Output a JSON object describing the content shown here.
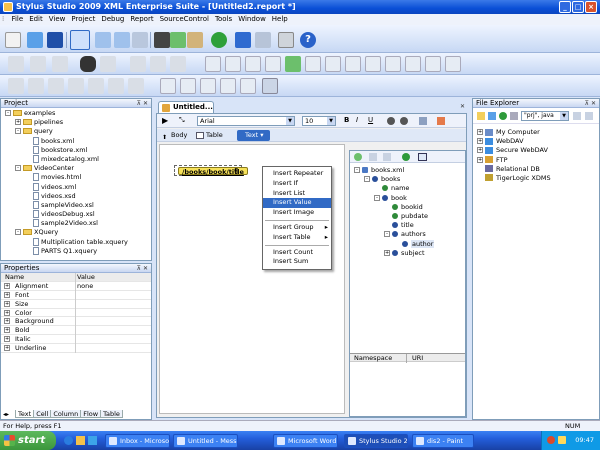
{
  "window": {
    "title": "Stylus Studio 2009 XML Enterprise Suite - [Untitled2.report *]"
  },
  "menu": [
    "File",
    "Edit",
    "View",
    "Project",
    "Debug",
    "Report",
    "SourceControl",
    "Tools",
    "Window",
    "Help"
  ],
  "project_panel": {
    "title": "Project",
    "tree": [
      {
        "label": "examples",
        "level": 0,
        "kind": "folder",
        "exp": "-"
      },
      {
        "label": "pipelines",
        "level": 1,
        "kind": "folder",
        "exp": "+"
      },
      {
        "label": "query",
        "level": 1,
        "kind": "folder",
        "exp": "-"
      },
      {
        "label": "books.xml",
        "level": 2,
        "kind": "file"
      },
      {
        "label": "bookstore.xml",
        "level": 2,
        "kind": "file"
      },
      {
        "label": "mixedcatalog.xml",
        "level": 2,
        "kind": "file"
      },
      {
        "label": "VideoCenter",
        "level": 1,
        "kind": "folder",
        "exp": "-"
      },
      {
        "label": "movies.html",
        "level": 2,
        "kind": "file"
      },
      {
        "label": "videos.xml",
        "level": 2,
        "kind": "file"
      },
      {
        "label": "videos.xsd",
        "level": 2,
        "kind": "file"
      },
      {
        "label": "sampleVideo.xsl",
        "level": 2,
        "kind": "file"
      },
      {
        "label": "videosDebug.xsl",
        "level": 2,
        "kind": "file"
      },
      {
        "label": "sample2Video.xsl",
        "level": 2,
        "kind": "file"
      },
      {
        "label": "XQuery",
        "level": 1,
        "kind": "folder",
        "exp": "-"
      },
      {
        "label": "Multiplication table.xquery",
        "level": 2,
        "kind": "file"
      },
      {
        "label": "PARTS Q1.xquery",
        "level": 2,
        "kind": "file"
      }
    ]
  },
  "properties_panel": {
    "title": "Properties",
    "col_name": "Name",
    "col_value": "Value",
    "rows": [
      {
        "name": "Alignment",
        "value": "none"
      },
      {
        "name": "Font",
        "value": ""
      },
      {
        "name": "Size",
        "value": ""
      },
      {
        "name": "Color",
        "value": ""
      },
      {
        "name": "Background",
        "value": ""
      },
      {
        "name": "Bold",
        "value": ""
      },
      {
        "name": "Italic",
        "value": ""
      },
      {
        "name": "Underline",
        "value": ""
      }
    ],
    "tabs": [
      "Text",
      "Cell",
      "Column",
      "Flow",
      "Table"
    ]
  },
  "editor": {
    "tab_label": "Untitled...",
    "font_name": "Arial",
    "font_size": "10",
    "format_buttons": [
      "B",
      "I",
      "U"
    ],
    "sub_tabs": [
      "Body",
      "Table",
      "Text"
    ],
    "node_text": "/books/book/title",
    "pilcrow": "¶"
  },
  "context_menu": {
    "groups": [
      [
        {
          "label": "Insert Repeater"
        },
        {
          "label": "Insert If"
        },
        {
          "label": "Insert List"
        },
        {
          "label": "Insert Value",
          "selected": true
        },
        {
          "label": "Insert Image"
        }
      ],
      [
        {
          "label": "Insert Group",
          "sub": true
        },
        {
          "label": "Insert Table",
          "sub": true
        }
      ],
      [
        {
          "label": "Insert Count"
        },
        {
          "label": "Insert Sum"
        }
      ]
    ],
    "submenu_arrow": "▸"
  },
  "schema_tree": {
    "items": [
      {
        "label": "books.xml",
        "level": 0
      },
      {
        "label": "books",
        "level": 1
      },
      {
        "label": "name",
        "level": 2
      },
      {
        "label": "book",
        "level": 2
      },
      {
        "label": "bookid",
        "level": 3
      },
      {
        "label": "pubdate",
        "level": 3
      },
      {
        "label": "title",
        "level": 3
      },
      {
        "label": "authors",
        "level": 3
      },
      {
        "label": "author",
        "level": 4,
        "selected": true
      },
      {
        "label": "subject",
        "level": 3
      }
    ],
    "ns_col": "Namespace",
    "uri_col": "URI"
  },
  "file_explorer": {
    "title": "File Explorer",
    "dropdown": "\"prj\", java",
    "items": [
      "My Computer",
      "WebDAV",
      "Secure WebDAV",
      "FTP",
      "Relational DB",
      "TigerLogic XDMS"
    ]
  },
  "status": {
    "help": "For Help, press F1",
    "num": "NUM"
  },
  "taskbar": {
    "start": "start",
    "tasks": [
      "Inbox - Microsoft ...",
      "Untitled - Messag...",
      "Microsoft Word",
      "Stylus Studio 2009...",
      "dis2 - Paint"
    ],
    "active_index": 3,
    "clock": "09:47"
  },
  "colors": {
    "accent": "#0a4fd6",
    "selection": "#316ac5",
    "node_fill": "#f6e15a"
  }
}
